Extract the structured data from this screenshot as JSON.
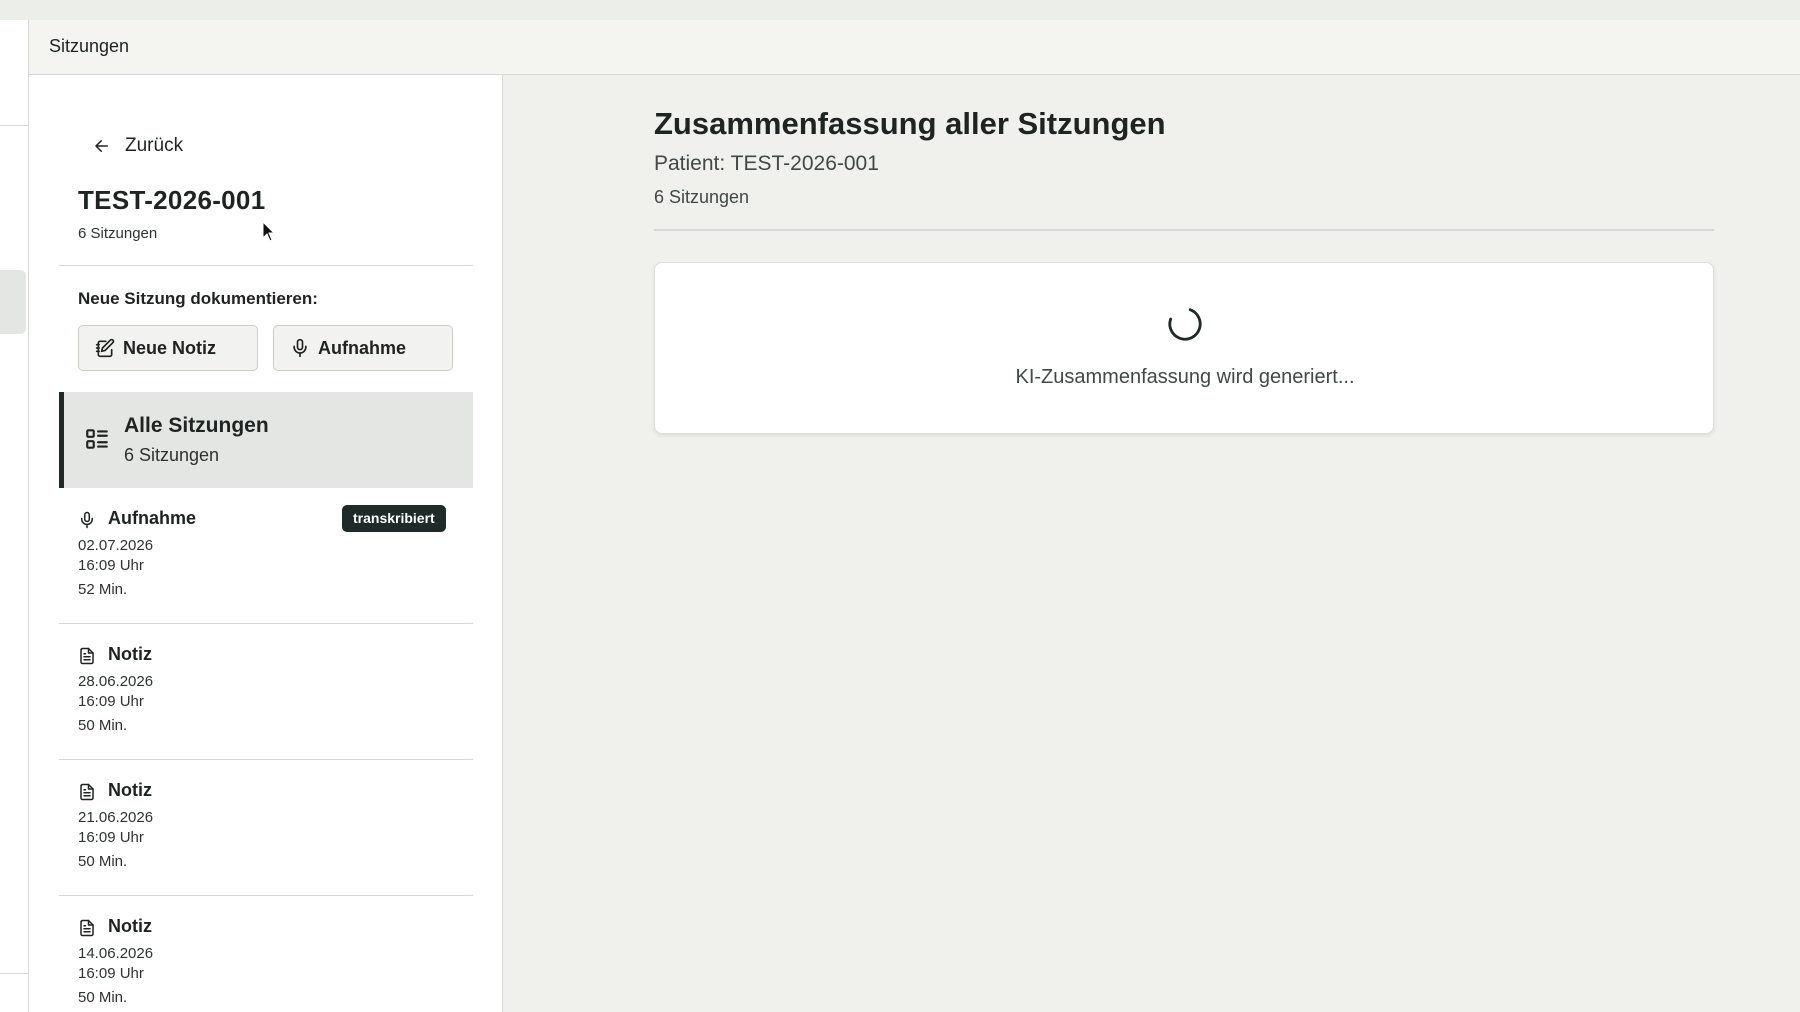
{
  "header": {
    "title": "Sitzungen"
  },
  "sidebar": {
    "back_label": "Zurück",
    "patient_id": "TEST-2026-001",
    "session_count": "6 Sitzungen",
    "new_session_label": "Neue Sitzung dokumentieren:",
    "new_note_label": "Neue Notiz",
    "record_label": "Aufnahme",
    "all_sessions": {
      "title": "Alle Sitzungen",
      "subtitle": "6 Sitzungen"
    },
    "sessions": [
      {
        "type": "Aufnahme",
        "icon": "mic-icon",
        "date": "02.07.2026",
        "time": "16:09 Uhr",
        "duration": "52 Min.",
        "badge": "transkribiert"
      },
      {
        "type": "Notiz",
        "icon": "document-icon",
        "date": "28.06.2026",
        "time": "16:09 Uhr",
        "duration": "50 Min."
      },
      {
        "type": "Notiz",
        "icon": "document-icon",
        "date": "21.06.2026",
        "time": "16:09 Uhr",
        "duration": "50 Min."
      },
      {
        "type": "Notiz",
        "icon": "document-icon",
        "date": "14.06.2026",
        "time": "16:09 Uhr",
        "duration": "50 Min."
      }
    ]
  },
  "main": {
    "title": "Zusammenfassung aller Sitzungen",
    "patient": "Patient: TEST-2026-001",
    "session_count": "6 Sitzungen",
    "loading_message": "KI-Zusammenfassung wird generiert..."
  },
  "colors": {
    "accent": "#1e2b28",
    "background": "#f0f1ed",
    "selected_bg": "#e3e6e3"
  }
}
